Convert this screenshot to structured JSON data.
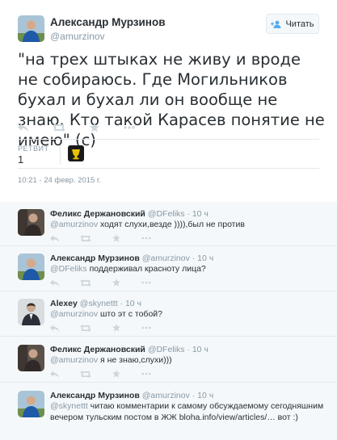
{
  "tweet": {
    "author_name": "Александр Мурзинов",
    "author_handle": "@amurzinov",
    "follow_label": "Читать",
    "text": "\"на трех штыках не живу и вроде не собираюсь. Где Могильников бухал и бухал ли он вообще не знаю. Кто такой Карасев понятие не имею\" (с)",
    "retweet_label": "РЕТВИТ",
    "retweet_count": "1",
    "timestamp": "10:21 - 24 февр. 2015 г.",
    "actions": [
      "reply-icon",
      "retweet-icon",
      "favorite-icon",
      "more-icon"
    ]
  },
  "replies": [
    {
      "name": "Феликс Держановский",
      "handle": "@DFeliks",
      "time": "· 10 ч",
      "mention": "@amurzinov",
      "text": " ходят слухи,везде )))),был не против"
    },
    {
      "name": "Александр Мурзинов",
      "handle": "@amurzinov",
      "time": "· 10 ч",
      "mention": "@DFeliks",
      "text": " поддерживал красноту лица?"
    },
    {
      "name": "Alexey",
      "handle": "@skynettt",
      "time": "· 10 ч",
      "mention": "@amurzinov",
      "text": " што эт с тобой?"
    },
    {
      "name": "Феликс Держановский",
      "handle": "@DFeliks",
      "time": "· 10 ч",
      "mention": "@amurzinov",
      "text": " я не знаю,слухи)))"
    },
    {
      "name": "Александр Мурзинов",
      "handle": "@amurzinov",
      "time": "· 10 ч",
      "mention": "@skynettt",
      "text": " читаю комментарии к самому обсуждаемому сегодняшним вечером тульским постом в ЖЖ bloha.info/view/articles/… вот :)"
    }
  ],
  "colors": {
    "text": "#292f33",
    "muted": "#8899a6",
    "border": "#e1e8ed",
    "reply_bg": "#f5f8fa"
  }
}
